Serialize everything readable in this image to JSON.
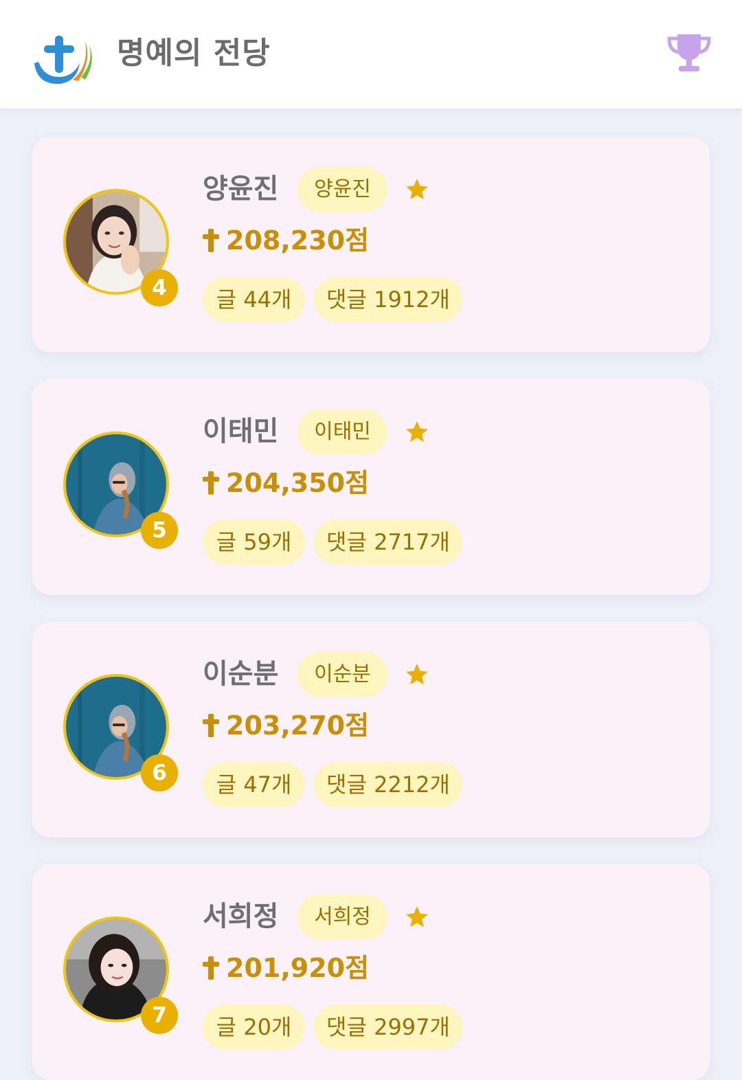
{
  "header": {
    "title": "명예의 전당"
  },
  "colors": {
    "accent": "#e9b000",
    "score": "#c98f00",
    "pill_bg": "#fff5bf",
    "pill_text": "#9a6f05",
    "card_bg": "#fbf1f8",
    "trophy": "#c6a4ec"
  },
  "icons": {
    "logo": "cross-logo-icon",
    "trophy": "trophy-icon",
    "star": "star-icon",
    "cross": "cross-icon"
  },
  "ranking": [
    {
      "rank": "4",
      "name": "양윤진",
      "nickname": "양윤진",
      "score": "208,230점",
      "posts": "글 44개",
      "comments": "댓글 1912개"
    },
    {
      "rank": "5",
      "name": "이태민",
      "nickname": "이태민",
      "score": "204,350점",
      "posts": "글 59개",
      "comments": "댓글 2717개"
    },
    {
      "rank": "6",
      "name": "이순분",
      "nickname": "이순분",
      "score": "203,270점",
      "posts": "글 47개",
      "comments": "댓글 2212개"
    },
    {
      "rank": "7",
      "name": "서희정",
      "nickname": "서희정",
      "score": "201,920점",
      "posts": "글 20개",
      "comments": "댓글 2997개"
    }
  ]
}
